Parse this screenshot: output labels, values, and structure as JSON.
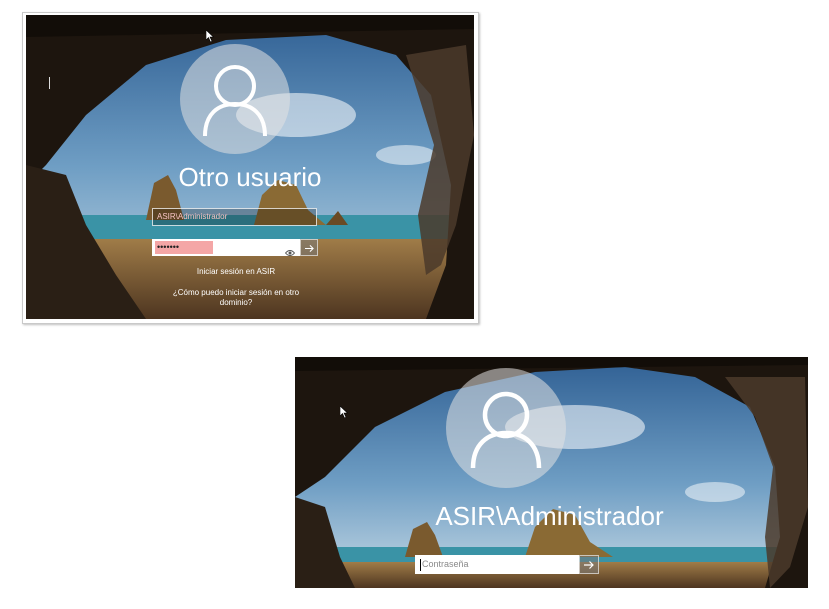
{
  "screen1": {
    "user_title": "Otro usuario",
    "username_value": "ASIR\\Administrador",
    "password_mask": "•••••••",
    "signin_domain_text": "Iniciar sesión en ASIR",
    "other_domain_link": "¿Cómo puedo iniciar sesión en otro dominio?",
    "reveal_icon": "eye-icon",
    "submit_icon": "arrow-right-icon",
    "highlight_color": "#f4a6a6"
  },
  "screen2": {
    "user_title": "ASIR\\Administrador",
    "password_placeholder": "Contraseña",
    "submit_icon": "arrow-right-icon"
  },
  "colors": {
    "sky": "#3f6f9e",
    "sea": "#2f8fa4",
    "sand": "#8a6a3c",
    "cave": "#1a130d",
    "text": "#ffffff"
  }
}
